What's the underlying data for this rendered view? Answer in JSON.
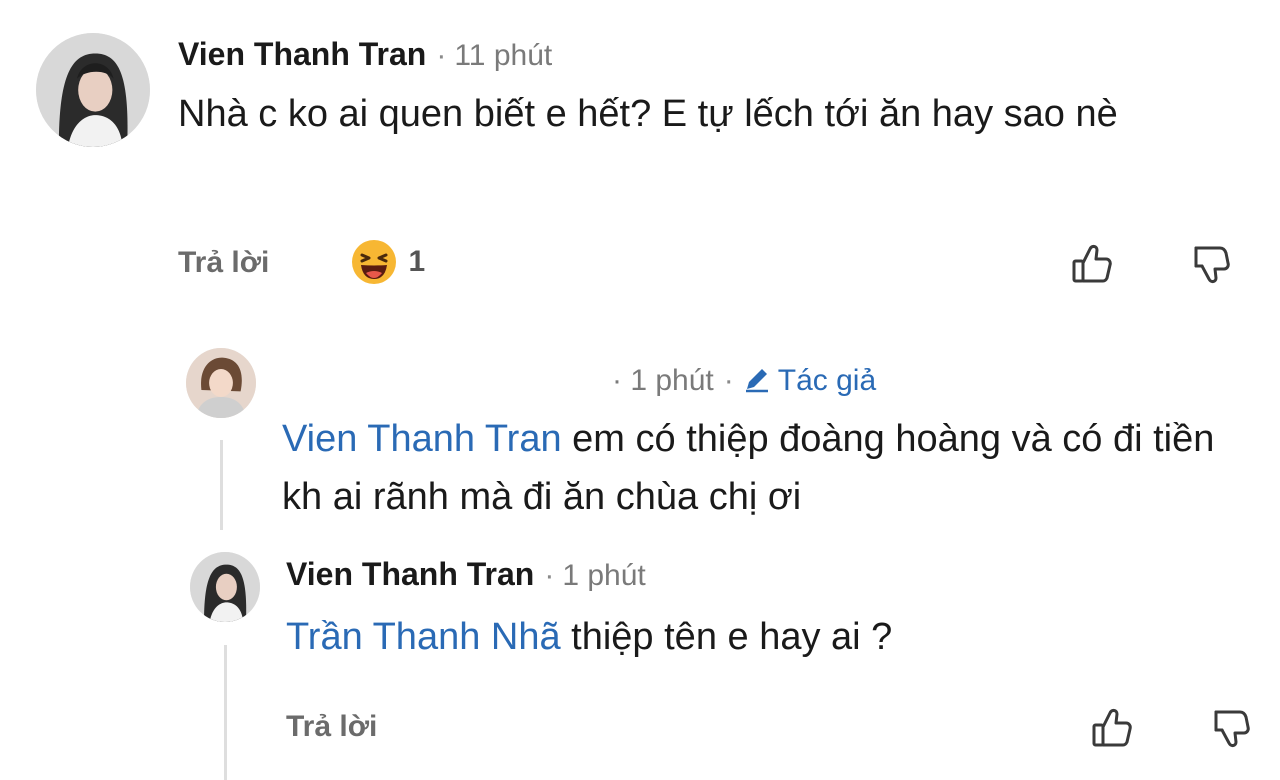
{
  "comment1": {
    "author": "Vien Thanh Tran",
    "time": "11 phút",
    "text": "Nhà c ko ai quen biết e hết? E tự lếch tới ăn hay sao nè",
    "reply_label": "Trả lời",
    "reaction_emoji": "laughing-emoji-icon",
    "reaction_count": "1",
    "like_icon": "thumbs-up-icon",
    "dislike_icon": "thumbs-down-icon"
  },
  "comment2": {
    "author": "",
    "time": "1 phút",
    "author_badge": "Tác giả",
    "badge_icon": "pencil-icon",
    "mention": "Vien Thanh Tran",
    "text": " em có thiệp đoàng hoàng và có đi tiền kh ai rãnh mà đi ăn chùa chị ơi"
  },
  "comment3": {
    "author": "Vien Thanh Tran",
    "time": "1 phút",
    "mention": "Trần Thanh Nhã",
    "text": " thiệp tên e hay ai ?",
    "reply_label": "Trả lời",
    "like_icon": "thumbs-up-icon",
    "dislike_icon": "thumbs-down-icon"
  },
  "colors": {
    "mention": "#2a6ab5",
    "meta": "#7a7a7a",
    "reaction": "#f7b733"
  }
}
